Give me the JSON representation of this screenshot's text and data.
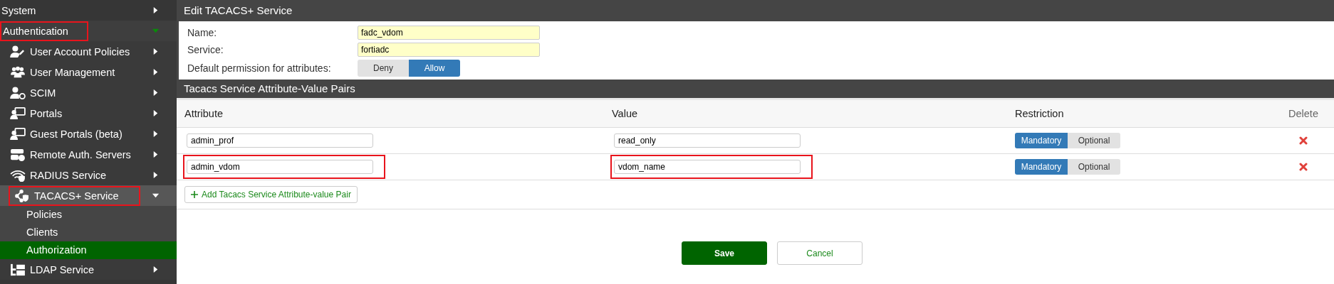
{
  "sidebar": {
    "items": [
      {
        "label": "System",
        "expanded": false,
        "highlighted": false
      },
      {
        "label": "Authentication",
        "expanded": true,
        "highlighted": true,
        "children": [
          {
            "label": "User Account Policies",
            "expanded": false,
            "highlighted": false
          },
          {
            "label": "User Management",
            "expanded": false,
            "highlighted": false
          },
          {
            "label": "SCIM",
            "expanded": false,
            "highlighted": false
          },
          {
            "label": "Portals",
            "expanded": false,
            "highlighted": false
          },
          {
            "label": "Guest Portals (beta)",
            "expanded": false,
            "highlighted": false
          },
          {
            "label": "Remote Auth. Servers",
            "expanded": false,
            "highlighted": false
          },
          {
            "label": "RADIUS Service",
            "expanded": false,
            "highlighted": false
          },
          {
            "label": "TACACS+ Service",
            "expanded": true,
            "highlighted": true,
            "children": [
              {
                "label": "Policies",
                "selected": false
              },
              {
                "label": "Clients",
                "selected": false
              },
              {
                "label": "Authorization",
                "selected": true
              }
            ]
          },
          {
            "label": "LDAP Service",
            "expanded": false,
            "highlighted": false
          }
        ]
      }
    ]
  },
  "panel": {
    "title": "Edit TACACS+ Service",
    "fields": [
      {
        "label": "Name:",
        "value": "fadc_vdom"
      },
      {
        "label": "Service:",
        "value": "fortiadc"
      }
    ],
    "permission": {
      "label": "Default permission for attributes:",
      "options": [
        {
          "label": "Deny",
          "selected": false
        },
        {
          "label": "Allow",
          "selected": true
        }
      ]
    }
  },
  "pairs": {
    "title": "Tacacs Service Attribute-Value Pairs",
    "columns": [
      "Attribute",
      "Value",
      "Restriction",
      "Delete"
    ],
    "rows": [
      {
        "attribute": "admin_prof",
        "value": "read_only",
        "highlighted": false,
        "restriction": [
          {
            "label": "Mandatory",
            "selected": true
          },
          {
            "label": "Optional",
            "selected": false
          }
        ]
      },
      {
        "attribute": "admin_vdom",
        "value": "vdom_name",
        "highlighted": true,
        "restriction": [
          {
            "label": "Mandatory",
            "selected": true
          },
          {
            "label": "Optional",
            "selected": false
          }
        ]
      }
    ],
    "add_button": "Add Tacacs Service Attribute-value Pair"
  },
  "buttons": [
    {
      "label": "Save",
      "kind": "primary"
    },
    {
      "label": "Cancel",
      "kind": "secondary"
    }
  ]
}
